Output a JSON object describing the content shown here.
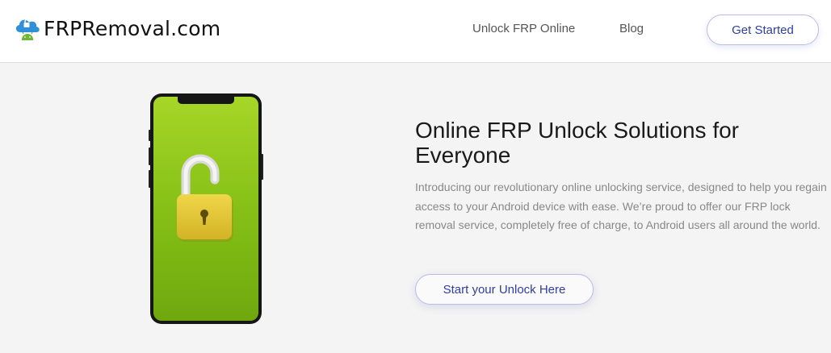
{
  "header": {
    "logo_text": "FRPRemoval.com",
    "nav": [
      {
        "label": "Unlock FRP Online"
      },
      {
        "label": "Blog"
      }
    ],
    "cta_label": "Get Started"
  },
  "hero": {
    "illustration": "phone-with-unlocked-padlock",
    "title": "Online FRP Unlock Solutions for Everyone",
    "description": "Introducing our revolutionary online unlocking service, designed to help you regain access to your Android device with ease. We’re proud to offer our FRP lock removal service, completely free of charge, to Android users all around the world.",
    "cta_label": "Start your Unlock Here"
  },
  "colors": {
    "accent": "#2f3ea3",
    "phone_screen": "#8cc412",
    "padlock": "#e2c332",
    "logo_cloud": "#2f8fd8",
    "logo_android": "#6fb73a"
  }
}
